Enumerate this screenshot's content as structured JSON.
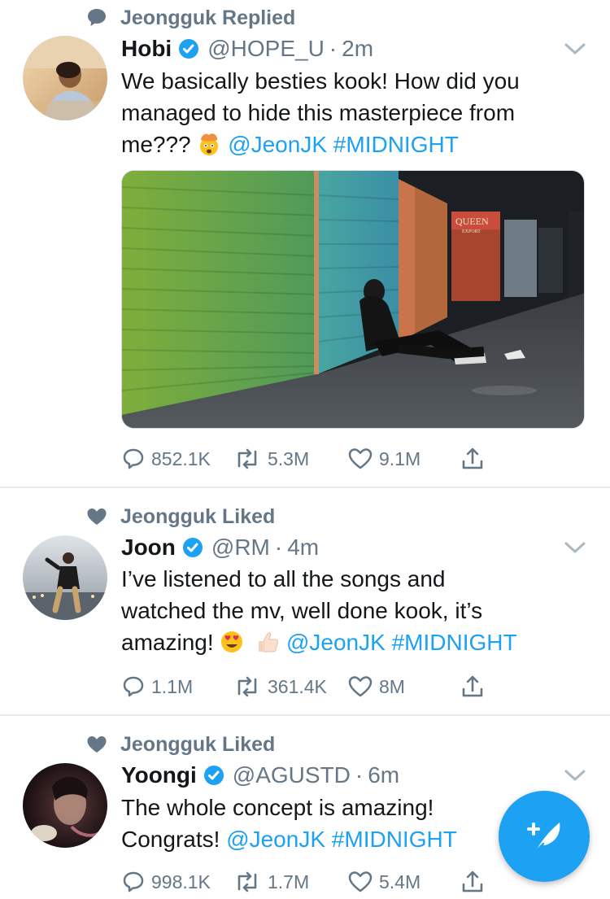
{
  "tweets": [
    {
      "context": "Jeongguk Replied",
      "context_icon": "speech-bubble-icon",
      "name": "Hobi",
      "handle": "@HOPE_U",
      "dot": "·",
      "time": "2m",
      "text_line1": "We basically besties kook! How did you",
      "text_line2": "managed to hide this masterpiece from",
      "text_line3_pre": "me???",
      "emoji": "exploding-head-emoji",
      "mention": "@JeonJK",
      "hashtag": "#MIDNIGHT",
      "replies": "852.1K",
      "retweets": "5.3M",
      "likes": "9.1M"
    },
    {
      "context": "Jeongguk Liked",
      "context_icon": "heart-icon",
      "name": "Joon",
      "handle": "@RM",
      "dot": "·",
      "time": "4m",
      "text_line1": "I’ve listened to all the songs and",
      "text_line2": "watched the mv, well done kook, it’s",
      "text_line3_pre": "amazing!",
      "emoji": "heart-eyes-emoji thumbs-up-emoji",
      "mention": "@JeonJK",
      "hashtag": "#MIDNIGHT",
      "replies": "1.1M",
      "retweets": "361.4K",
      "likes": "8M"
    },
    {
      "context": "Jeongguk Liked",
      "context_icon": "heart-icon",
      "name": "Yoongi",
      "handle": "@AGUSTD",
      "dot": "·",
      "time": "6m",
      "text_line1": "The whole concept is amazing!",
      "text_line2_pre": "Congrats!",
      "mention": "@JeonJK",
      "hashtag": "#MIDNIGHT",
      "replies": "998.1K",
      "retweets": "1.7M",
      "likes": "5.4M"
    }
  ],
  "media_sign": "QUEEN",
  "media_sign_sub": "EXPORT",
  "colors": {
    "link": "#1da1f2",
    "muted": "#657786",
    "text": "#14171a",
    "divider": "#e6ecf0"
  }
}
